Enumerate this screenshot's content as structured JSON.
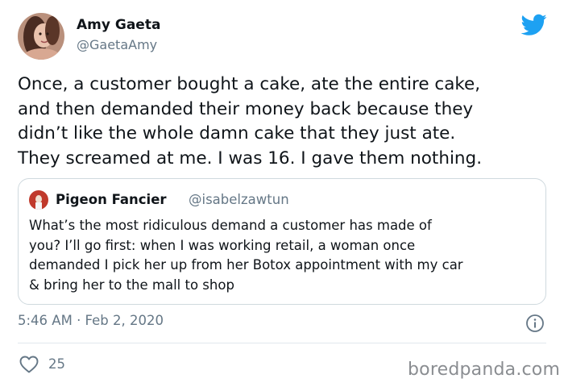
{
  "author": {
    "name": "Amy Gaeta",
    "handle": "@GaetaAmy",
    "avatar_icon": "profile-photo"
  },
  "tweet": {
    "text": "Once, a customer bought a cake, ate the entire cake,\nand then demanded their money back because they\ndidn’t like the whole damn cake that they just ate.\nThey screamed at me. I was 16. I gave them nothing."
  },
  "quoted_tweet": {
    "name": "Pigeon Fancier",
    "handle": "@isabelzawtun",
    "text": "What’s the most ridiculous demand a customer has made of\nyou? I’ll go first: when I was working retail, a woman once\ndemanded I pick her up from her Botox appointment with my car\n& bring her to the mall to shop"
  },
  "meta": {
    "timestamp": "5:46 AM · Feb 2, 2020",
    "like_count": "25"
  },
  "watermark": "boredpanda.com",
  "colors": {
    "twitter_blue": "#1da1f2",
    "secondary_text": "#657786",
    "border": "#cfd9de"
  }
}
